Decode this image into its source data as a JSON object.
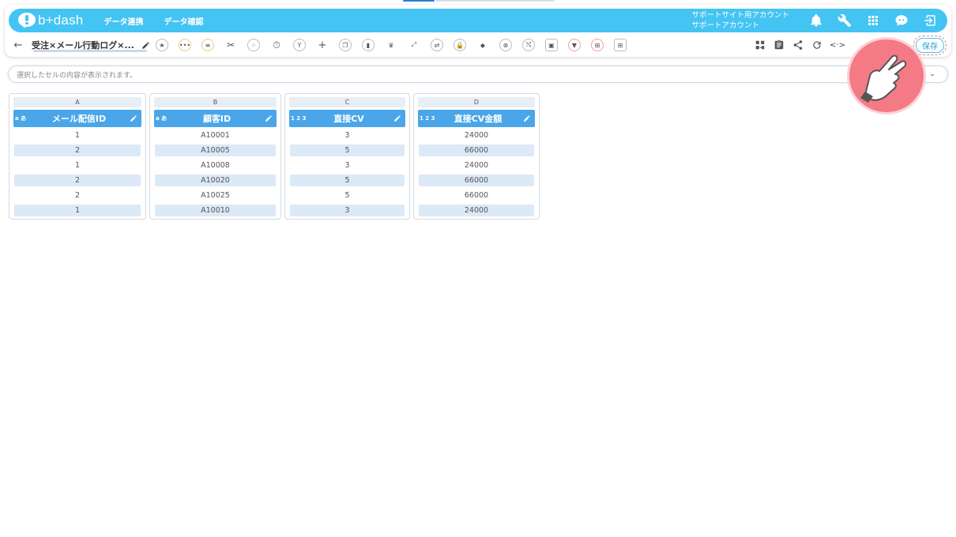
{
  "app": {
    "brand": "b+dash"
  },
  "nav": {
    "links": [
      "データ連携",
      "データ確認"
    ],
    "account_line1": "サポートサイト用アカウント",
    "account_line2": "サポートアカウント",
    "icons": [
      "bell-icon",
      "wrench-icon",
      "apps-grid-icon",
      "chat-icon",
      "logout-icon"
    ]
  },
  "toolbar": {
    "back": "←",
    "title": "受注×メール行動ログ×...",
    "save_label": "保存",
    "tools": [
      "star-icon",
      "more-icon",
      "filter-lines-icon",
      "scissors-icon",
      "merge-icon",
      "timer-icon",
      "branch-icon",
      "add-icon",
      "copy-icon",
      "delete-icon",
      "crown-icon",
      "expand-icon",
      "swap-icon",
      "lock-icon",
      "cube-icon",
      "cancel-icon",
      "shuffle-icon",
      "frame-icon",
      "funnel-icon",
      "pivot-icon",
      "table-icon"
    ],
    "right_tools": [
      "flow-icon",
      "clipboard-icon",
      "share-icon",
      "refresh-icon",
      "code-icon"
    ],
    "code_glyph": "<·>"
  },
  "formula_bar": {
    "placeholder": "選択したセルの内容が表示されます。",
    "chevron": "⌄"
  },
  "columns": [
    {
      "letter": "A",
      "type": "a あ",
      "name": "メール配信ID",
      "values": [
        "1",
        "2",
        "1",
        "2",
        "2",
        "1"
      ]
    },
    {
      "letter": "B",
      "type": "a あ",
      "name": "顧客ID",
      "values": [
        "A10001",
        "A10005",
        "A10008",
        "A10020",
        "A10025",
        "A10010"
      ]
    },
    {
      "letter": "C",
      "type": "1 2 3",
      "name": "直接CV",
      "values": [
        "3",
        "5",
        "3",
        "5",
        "5",
        "3"
      ]
    },
    {
      "letter": "D",
      "type": "1 2 3",
      "name": "直接CV金額",
      "values": [
        "24000",
        "66000",
        "24000",
        "66000",
        "66000",
        "24000"
      ]
    }
  ],
  "colors": {
    "nav": "#44c4f3",
    "header": "#4aa6e8",
    "alt_row": "#dce9f7",
    "highlight": "#f47a85"
  }
}
